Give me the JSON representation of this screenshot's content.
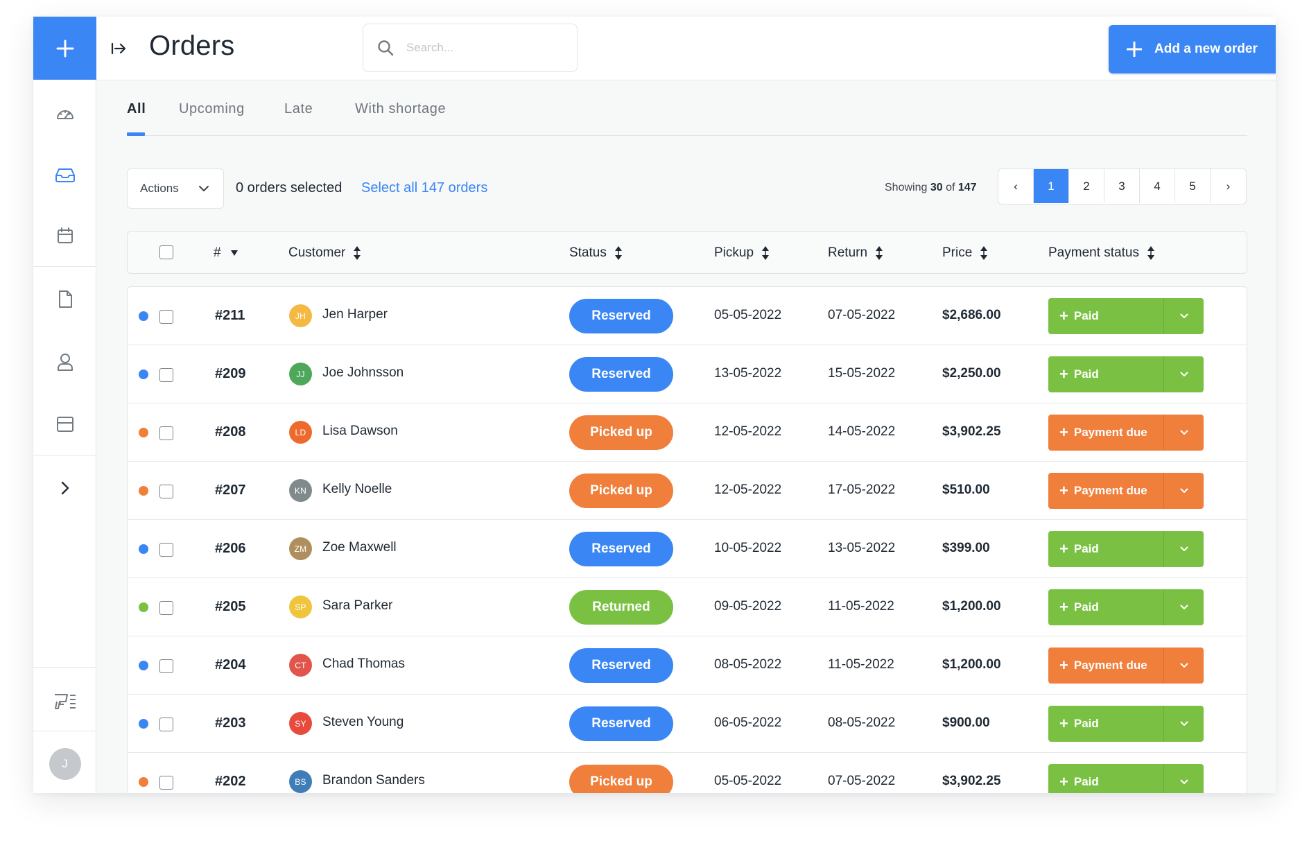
{
  "header": {
    "title": "Orders",
    "search_placeholder": "Search...",
    "add_order_label": "Add a new order"
  },
  "sidebar": {
    "items": [
      {
        "name": "dashboard",
        "icon": "speedometer-icon"
      },
      {
        "name": "orders",
        "icon": "inbox-icon",
        "active": true
      },
      {
        "name": "calendar",
        "icon": "calendar-icon"
      },
      {
        "name": "documents",
        "icon": "document-icon"
      },
      {
        "name": "customers",
        "icon": "user-icon"
      },
      {
        "name": "inventory",
        "icon": "box-icon"
      },
      {
        "name": "expand",
        "icon": "chevron-right-icon"
      },
      {
        "name": "bulk-scan",
        "icon": "scanner-icon"
      }
    ],
    "user_initial": "J"
  },
  "tabs": [
    {
      "label": "All",
      "active": true
    },
    {
      "label": "Upcoming"
    },
    {
      "label": "Late"
    },
    {
      "label": "With shortage"
    }
  ],
  "toolbar": {
    "actions_label": "Actions",
    "selected_text": "0 orders selected",
    "select_all_text": "Select all 147 orders",
    "showing_prefix": "Showing",
    "showing_count": "30",
    "showing_of": "of",
    "showing_total": "147"
  },
  "pagination": {
    "prev": "‹",
    "pages": [
      "1",
      "2",
      "3",
      "4",
      "5"
    ],
    "current": "1",
    "next": "›"
  },
  "table": {
    "columns": [
      "#",
      "Customer",
      "Status",
      "Pickup",
      "Return",
      "Price",
      "Payment status"
    ],
    "rows": [
      {
        "dot": "#3a86f5",
        "number": "#211",
        "initials": "JH",
        "avatar_color": "#f4b942",
        "customer": "Jen Harper",
        "status": "Reserved",
        "status_color": "#3a86f5",
        "pickup": "05-05-2022",
        "return": "07-05-2022",
        "price": "$2,686.00",
        "payment": "Paid",
        "payment_color": "#7ac143"
      },
      {
        "dot": "#3a86f5",
        "number": "#209",
        "initials": "JJ",
        "avatar_color": "#4fa75b",
        "customer": "Joe Johnsson",
        "status": "Reserved",
        "status_color": "#3a86f5",
        "pickup": "13-05-2022",
        "return": "15-05-2022",
        "price": "$2,250.00",
        "payment": "Paid",
        "payment_color": "#7ac143"
      },
      {
        "dot": "#f07f3c",
        "number": "#208",
        "initials": "LD",
        "avatar_color": "#ee6a2c",
        "customer": "Lisa Dawson",
        "status": "Picked up",
        "status_color": "#f07f3c",
        "pickup": "12-05-2022",
        "return": "14-05-2022",
        "price": "$3,902.25",
        "payment": "Payment due",
        "payment_color": "#f07f3c"
      },
      {
        "dot": "#f07f3c",
        "number": "#207",
        "initials": "KN",
        "avatar_color": "#808a8c",
        "customer": "Kelly Noelle",
        "status": "Picked up",
        "status_color": "#f07f3c",
        "pickup": "12-05-2022",
        "return": "17-05-2022",
        "price": "$510.00",
        "payment": "Payment due",
        "payment_color": "#f07f3c"
      },
      {
        "dot": "#3a86f5",
        "number": "#206",
        "initials": "ZM",
        "avatar_color": "#b08f5e",
        "customer": "Zoe Maxwell",
        "status": "Reserved",
        "status_color": "#3a86f5",
        "pickup": "10-05-2022",
        "return": "13-05-2022",
        "price": "$399.00",
        "payment": "Paid",
        "payment_color": "#7ac143"
      },
      {
        "dot": "#7ac143",
        "number": "#205",
        "initials": "SP",
        "avatar_color": "#f0c53e",
        "customer": "Sara Parker",
        "status": "Returned",
        "status_color": "#7ac143",
        "pickup": "09-05-2022",
        "return": "11-05-2022",
        "price": "$1,200.00",
        "payment": "Paid",
        "payment_color": "#7ac143"
      },
      {
        "dot": "#3a86f5",
        "number": "#204",
        "initials": "CT",
        "avatar_color": "#e2554a",
        "customer": "Chad Thomas",
        "status": "Reserved",
        "status_color": "#3a86f5",
        "pickup": "08-05-2022",
        "return": "11-05-2022",
        "price": "$1,200.00",
        "payment": "Payment due",
        "payment_color": "#f07f3c"
      },
      {
        "dot": "#3a86f5",
        "number": "#203",
        "initials": "SY",
        "avatar_color": "#e84a3c",
        "customer": "Steven Young",
        "status": "Reserved",
        "status_color": "#3a86f5",
        "pickup": "06-05-2022",
        "return": "08-05-2022",
        "price": "$900.00",
        "payment": "Paid",
        "payment_color": "#7ac143"
      },
      {
        "dot": "#f07f3c",
        "number": "#202",
        "initials": "BS",
        "avatar_color": "#3f7db8",
        "customer": "Brandon Sanders",
        "status": "Picked up",
        "status_color": "#f07f3c",
        "pickup": "05-05-2022",
        "return": "07-05-2022",
        "price": "$3,902.25",
        "payment": "Paid",
        "payment_color": "#7ac143"
      }
    ]
  },
  "colors": {
    "accent": "#3a86f5",
    "green": "#7ac143",
    "orange": "#f07f3c"
  }
}
